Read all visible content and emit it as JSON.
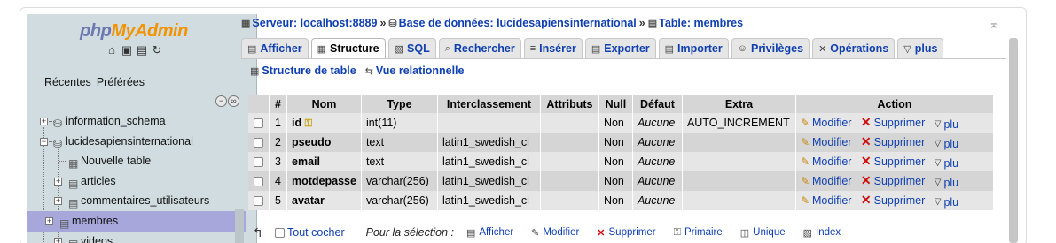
{
  "nav": {
    "logo_php": "php",
    "logo_myadmin": "MyAdmin",
    "tabs": [
      "Récentes",
      "Préférées"
    ],
    "tree": [
      {
        "label": "information_schema",
        "expander": "+"
      },
      {
        "label": "lucidesapiensinternational",
        "expander": "−"
      },
      {
        "label": "Nouvelle table",
        "expander": ""
      },
      {
        "label": "articles",
        "expander": "+"
      },
      {
        "label": "commentaires_utilisateurs",
        "expander": "+"
      },
      {
        "label": "membres",
        "expander": "+",
        "selected": true
      },
      {
        "label": "videos",
        "expander": "+"
      }
    ]
  },
  "breadcrumb": {
    "server": "Serveur: localhost:8889",
    "database": "Base de données: lucidesapiensinternational",
    "table": "Table: membres",
    "separator": "»"
  },
  "tabs": [
    {
      "label": "Afficher",
      "icon": "browse-icon"
    },
    {
      "label": "Structure",
      "icon": "structure-icon",
      "active": true
    },
    {
      "label": "SQL",
      "icon": "sql-icon"
    },
    {
      "label": "Rechercher",
      "icon": "search-icon"
    },
    {
      "label": "Insérer",
      "icon": "insert-icon"
    },
    {
      "label": "Exporter",
      "icon": "export-icon"
    },
    {
      "label": "Importer",
      "icon": "import-icon"
    },
    {
      "label": "Privilèges",
      "icon": "privileges-icon"
    },
    {
      "label": "Opérations",
      "icon": "operations-icon"
    },
    {
      "label": "plus",
      "icon": "chevron-down-icon"
    }
  ],
  "subnav": [
    "Structure de table",
    "Vue relationnelle"
  ],
  "table": {
    "headers": [
      "#",
      "Nom",
      "Type",
      "Interclassement",
      "Attributs",
      "Null",
      "Défaut",
      "Extra",
      "Action"
    ],
    "rows": [
      {
        "num": "1",
        "name": "id",
        "type": "int(11)",
        "collation": "",
        "attributes": "",
        "null": "Non",
        "default": "Aucune",
        "extra": "AUTO_INCREMENT",
        "primary": true
      },
      {
        "num": "2",
        "name": "pseudo",
        "type": "text",
        "collation": "latin1_swedish_ci",
        "attributes": "",
        "null": "Non",
        "default": "Aucune",
        "extra": ""
      },
      {
        "num": "3",
        "name": "email",
        "type": "text",
        "collation": "latin1_swedish_ci",
        "attributes": "",
        "null": "Non",
        "default": "Aucune",
        "extra": ""
      },
      {
        "num": "4",
        "name": "motdepasse",
        "type": "varchar(256)",
        "collation": "latin1_swedish_ci",
        "attributes": "",
        "null": "Non",
        "default": "Aucune",
        "extra": ""
      },
      {
        "num": "5",
        "name": "avatar",
        "type": "varchar(256)",
        "collation": "latin1_swedish_ci",
        "attributes": "",
        "null": "Non",
        "default": "Aucune",
        "extra": ""
      }
    ],
    "actions": {
      "modify": "Modifier",
      "delete": "Supprimer",
      "more": "plu"
    }
  },
  "footer": {
    "check_all": "Tout cocher",
    "with_selection": "Pour la sélection :",
    "actions": [
      "Afficher",
      "Modifier",
      "Supprimer",
      "Primaire",
      "Unique",
      "Index"
    ]
  },
  "colors": {
    "link": "#1040b0",
    "nav_bg": "#d0dce0",
    "selected_nav": "#a7a7dc",
    "delete": "#d01010"
  }
}
